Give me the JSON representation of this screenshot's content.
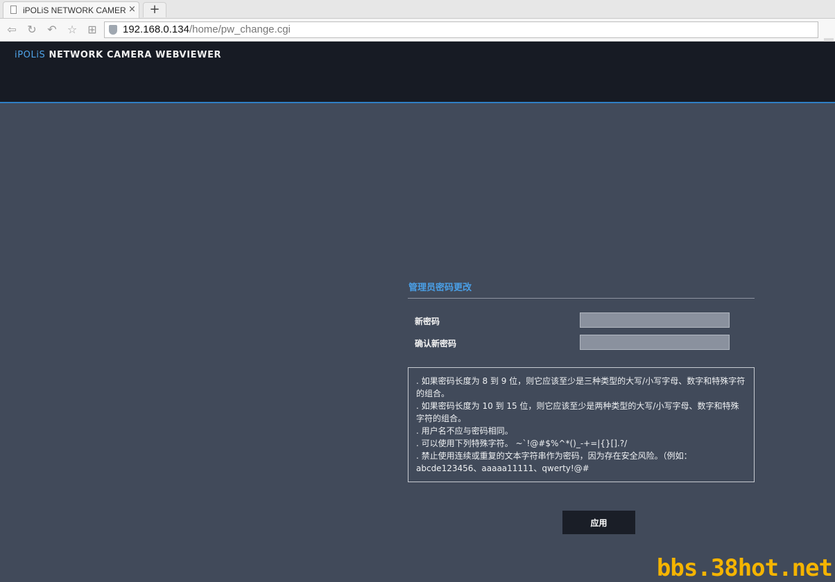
{
  "browser": {
    "tab_title": "iPOLiS NETWORK CAMER",
    "tab_close": "×",
    "new_tab": "+",
    "url_host": "192.168.0.134",
    "url_path": "/home/pw_change.cgi",
    "icons": [
      "back-icon",
      "reload-icon",
      "history-icon",
      "bookmark-star-icon",
      "apps-grid-icon",
      "site-shield-icon"
    ]
  },
  "header": {
    "brand_accent": "iPOLiS",
    "brand_rest": " NETWORK CAMERA WEBVIEWER",
    "accent_color": "#4fa3e8"
  },
  "form": {
    "title": "管理员密码更改",
    "new_password_label": "新密码",
    "confirm_password_label": "确认新密码",
    "new_password_value": "",
    "confirm_password_value": "",
    "rules": [
      ". 如果密码长度为 8 到 9 位，则它应该至少是三种类型的大写/小写字母、数字和特殊字符的组合。",
      ". 如果密码长度为 10 到 15 位，则它应该至少是两种类型的大写/小写字母、数字和特殊字符的组合。",
      ". 用户名不应与密码相同。",
      ". 可以使用下列特殊字符。 ~`!@#$%^*()_-+=|{}[].?/",
      ". 禁止使用连续或重复的文本字符串作为密码，因为存在安全风险。（例如：abcde123456、aaaaa11111、qwerty!@#"
    ],
    "apply_label": "应用"
  },
  "watermark": "bbs.38hot.net"
}
